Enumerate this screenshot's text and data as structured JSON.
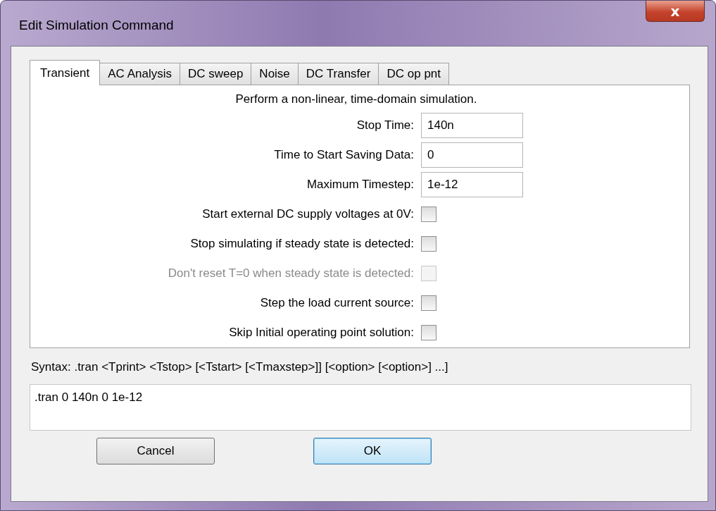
{
  "window": {
    "title": "Edit Simulation Command",
    "close_label": "x"
  },
  "tabs": [
    {
      "label": "Transient",
      "selected": true
    },
    {
      "label": "AC Analysis",
      "selected": false
    },
    {
      "label": "DC sweep",
      "selected": false
    },
    {
      "label": "Noise",
      "selected": false
    },
    {
      "label": "DC Transfer",
      "selected": false
    },
    {
      "label": "DC op pnt",
      "selected": false
    }
  ],
  "description": "Perform a non-linear, time-domain simulation.",
  "fields": [
    {
      "label": "Stop Time:",
      "value": "140n"
    },
    {
      "label": "Time to Start Saving Data:",
      "value": "0"
    },
    {
      "label": "Maximum Timestep:",
      "value": "1e-12"
    }
  ],
  "options": [
    {
      "label": "Start external DC supply voltages at 0V:",
      "checked": false,
      "disabled": false
    },
    {
      "label": "Stop simulating if steady state is detected:",
      "checked": false,
      "disabled": false
    },
    {
      "label": "Don't reset T=0 when steady state is detected:",
      "checked": false,
      "disabled": true
    },
    {
      "label": "Step the load current source:",
      "checked": false,
      "disabled": false
    },
    {
      "label": "Skip Initial operating point solution:",
      "checked": false,
      "disabled": false
    }
  ],
  "syntax": "Syntax:  .tran <Tprint> <Tstop> [<Tstart> [<Tmaxstep>]] [<option> [<option>] ...]",
  "command": ".tran 0 140n 0 1e-12",
  "buttons": [
    {
      "label": "Cancel",
      "default": false
    },
    {
      "label": "OK",
      "default": true
    }
  ]
}
